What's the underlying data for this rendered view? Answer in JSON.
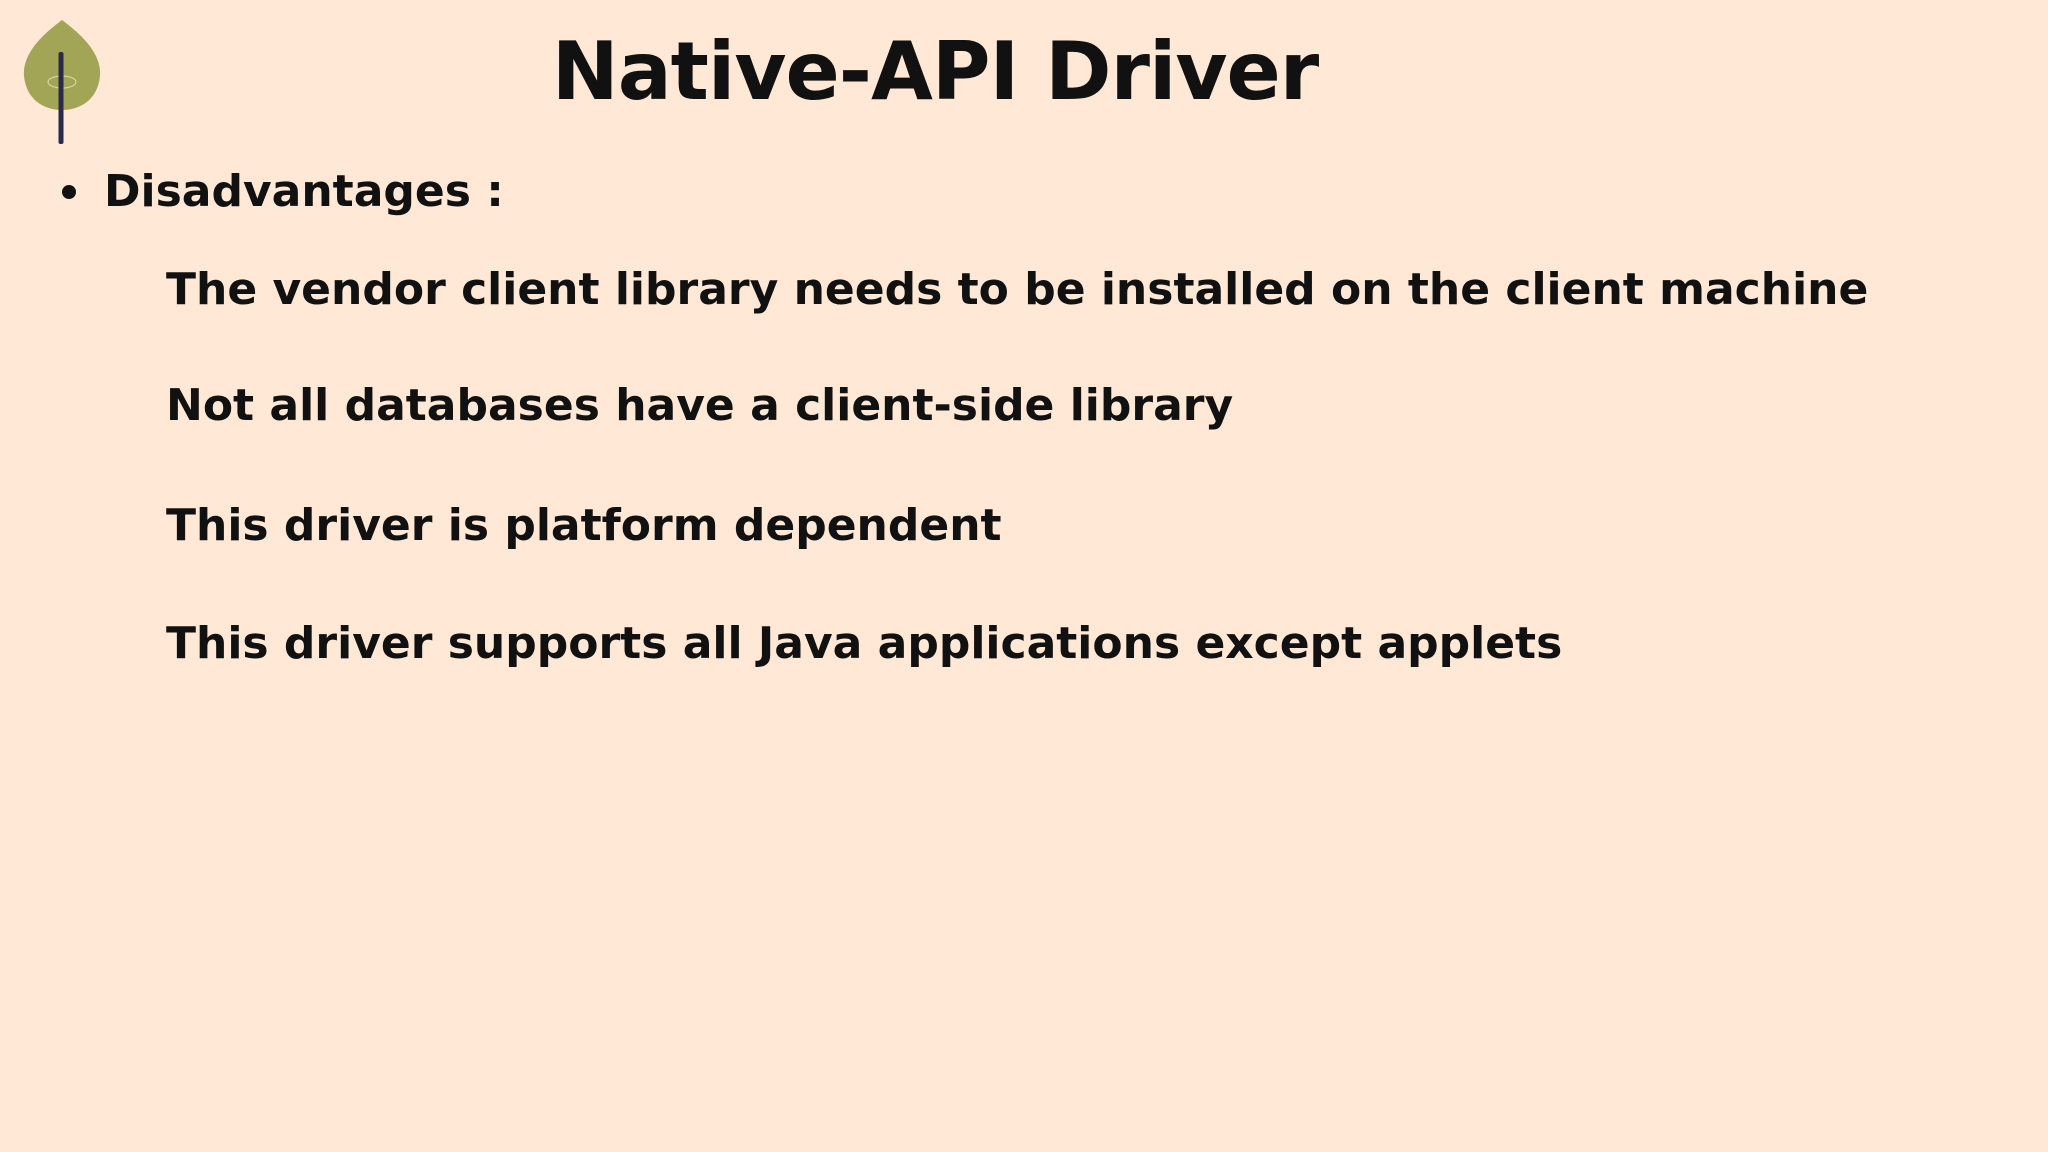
{
  "slide": {
    "title": "Native-API Driver",
    "section": {
      "label": "Disadvantages :",
      "points": [
        "The vendor client library needs to be installed on the client machine",
        "Not all databases have a client-side library",
        "This driver is platform dependent",
        "This driver supports all Java applications except applets"
      ]
    }
  },
  "colors": {
    "background": "#ffe8d6",
    "text": "#111111",
    "logo_leaf": "#a3a556",
    "logo_stem": "#2a2a4a"
  },
  "icons": {
    "logo": "leaf-logo-icon",
    "bullet": "bullet-dot-icon"
  }
}
